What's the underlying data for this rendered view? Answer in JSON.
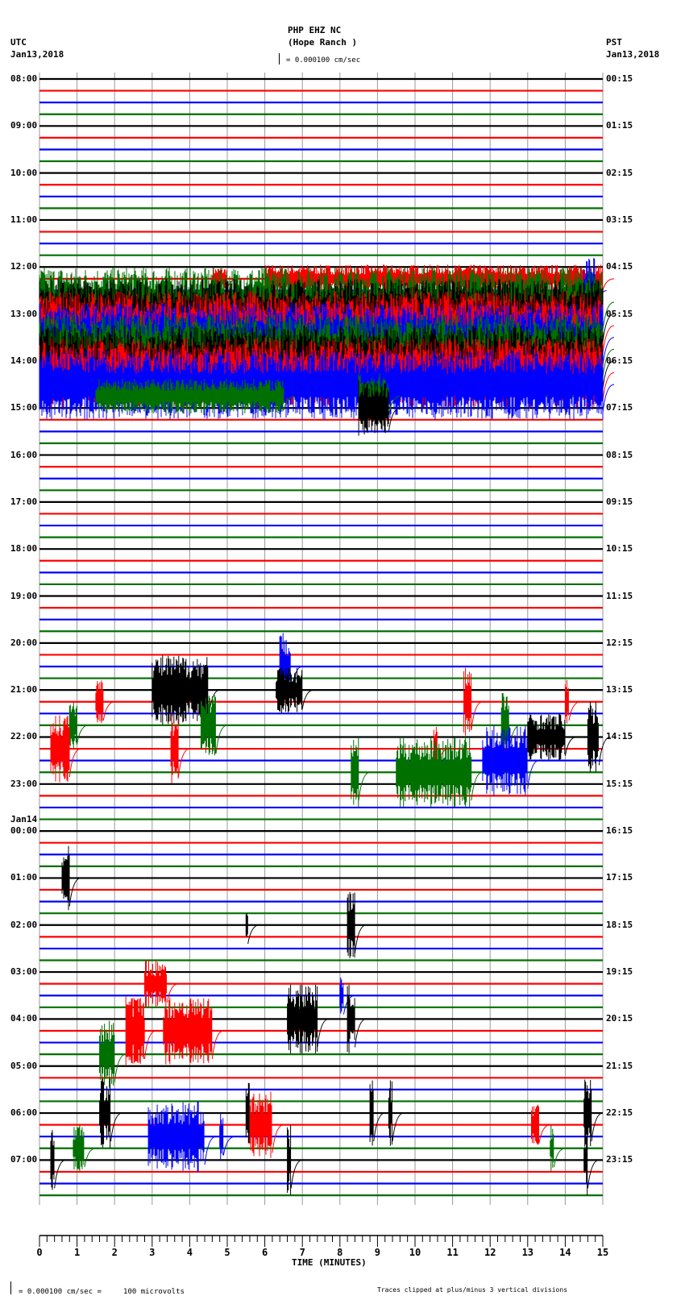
{
  "header": {
    "station": "PHP EHZ NC",
    "location": "(Hope Ranch )",
    "left_tz": "UTC",
    "left_date": "Jan13,2018",
    "right_tz": "PST",
    "right_date": "Jan13,2018",
    "scale": "= 0.000100 cm/sec"
  },
  "footer": {
    "scale": "= 0.000100 cm/sec =     100 microvolts",
    "clip_note": "Traces clipped at plus/minus 3 vertical divisions"
  },
  "chart_data": {
    "type": "line",
    "title": "PHP EHZ NC (Hope Ranch ) helicorder",
    "xlabel": "TIME (MINUTES)",
    "xlim": [
      0,
      15
    ],
    "x_ticks": [
      "0",
      "1",
      "2",
      "3",
      "4",
      "5",
      "6",
      "7",
      "8",
      "9",
      "10",
      "11",
      "12",
      "13",
      "14",
      "15"
    ],
    "traces_per_hour": 4,
    "trace_count": 96,
    "trace_colors": [
      "#000000",
      "#ff0000",
      "#0000ff",
      "#007000"
    ],
    "left_labels": [
      "08:00",
      "09:00",
      "10:00",
      "11:00",
      "12:00",
      "13:00",
      "14:00",
      "15:00",
      "16:00",
      "17:00",
      "18:00",
      "19:00",
      "20:00",
      "21:00",
      "22:00",
      "23:00",
      "00:00",
      "01:00",
      "02:00",
      "03:00",
      "04:00",
      "05:00",
      "06:00",
      "07:00"
    ],
    "left_date_change": {
      "label": "Jan14",
      "hour_index": 16
    },
    "right_labels": [
      "00:15",
      "01:15",
      "02:15",
      "03:15",
      "04:15",
      "05:15",
      "06:15",
      "07:15",
      "08:15",
      "09:15",
      "10:15",
      "11:15",
      "12:15",
      "13:15",
      "14:15",
      "15:15",
      "16:15",
      "17:15",
      "18:15",
      "19:15",
      "20:15",
      "21:15",
      "22:15",
      "23:15"
    ],
    "clip_divisions": 3,
    "events_note": "[trace_index, start_min, end_min, amplitude_divisions]",
    "events": [
      [
        17,
        4.6,
        5.0,
        1.0
      ],
      [
        17,
        6.0,
        15,
        1.2
      ],
      [
        18,
        14.5,
        14.8,
        3
      ],
      [
        19,
        0,
        15,
        3
      ],
      [
        20,
        0,
        15,
        3
      ],
      [
        21,
        0,
        15,
        3
      ],
      [
        22,
        0,
        15,
        3
      ],
      [
        23,
        0,
        15,
        3
      ],
      [
        24,
        0,
        15,
        3
      ],
      [
        25,
        0,
        15,
        3
      ],
      [
        26,
        0,
        15,
        3
      ],
      [
        27,
        1.5,
        6.5,
        1.5
      ],
      [
        27,
        8.5,
        9.3,
        2
      ],
      [
        28,
        8.5,
        9.3,
        2.5
      ],
      [
        50,
        6.4,
        6.7,
        3
      ],
      [
        52,
        3.0,
        4.5,
        3
      ],
      [
        52,
        6.3,
        7.0,
        2
      ],
      [
        53,
        1.5,
        1.7,
        2
      ],
      [
        53,
        11.3,
        11.5,
        3
      ],
      [
        53,
        14.0,
        14.1,
        2
      ],
      [
        55,
        0.8,
        1.0,
        2
      ],
      [
        55,
        4.3,
        4.7,
        3
      ],
      [
        55,
        12.3,
        12.5,
        3
      ],
      [
        56,
        13.0,
        14.0,
        2
      ],
      [
        56,
        14.6,
        14.9,
        3
      ],
      [
        57,
        0.3,
        0.8,
        3
      ],
      [
        57,
        3.5,
        3.7,
        3
      ],
      [
        57,
        10.5,
        10.6,
        2
      ],
      [
        58,
        11.8,
        13.0,
        3
      ],
      [
        59,
        8.3,
        8.5,
        3
      ],
      [
        59,
        9.5,
        11.5,
        3
      ],
      [
        68,
        0.6,
        0.8,
        3
      ],
      [
        72,
        8.2,
        8.4,
        3
      ],
      [
        72,
        5.5,
        5.55,
        2
      ],
      [
        77,
        2.8,
        3.4,
        2
      ],
      [
        78,
        8.0,
        8.1,
        2
      ],
      [
        80,
        6.6,
        7.4,
        3
      ],
      [
        80,
        8.2,
        8.4,
        3
      ],
      [
        81,
        2.3,
        2.8,
        3
      ],
      [
        81,
        3.3,
        4.6,
        3
      ],
      [
        83,
        1.6,
        2.0,
        3
      ],
      [
        88,
        1.6,
        1.9,
        3
      ],
      [
        88,
        5.5,
        5.6,
        3
      ],
      [
        88,
        8.8,
        8.9,
        3
      ],
      [
        88,
        9.3,
        9.4,
        3
      ],
      [
        88,
        14.5,
        14.7,
        3
      ],
      [
        89,
        5.6,
        6.2,
        3
      ],
      [
        89,
        13.1,
        13.3,
        2
      ],
      [
        90,
        2.9,
        4.4,
        3
      ],
      [
        90,
        4.8,
        4.9,
        2
      ],
      [
        91,
        0.9,
        1.2,
        2
      ],
      [
        91,
        13.6,
        13.7,
        2
      ],
      [
        92,
        0.3,
        0.4,
        3
      ],
      [
        92,
        6.6,
        6.7,
        3
      ],
      [
        92,
        14.5,
        14.6,
        3
      ]
    ]
  }
}
